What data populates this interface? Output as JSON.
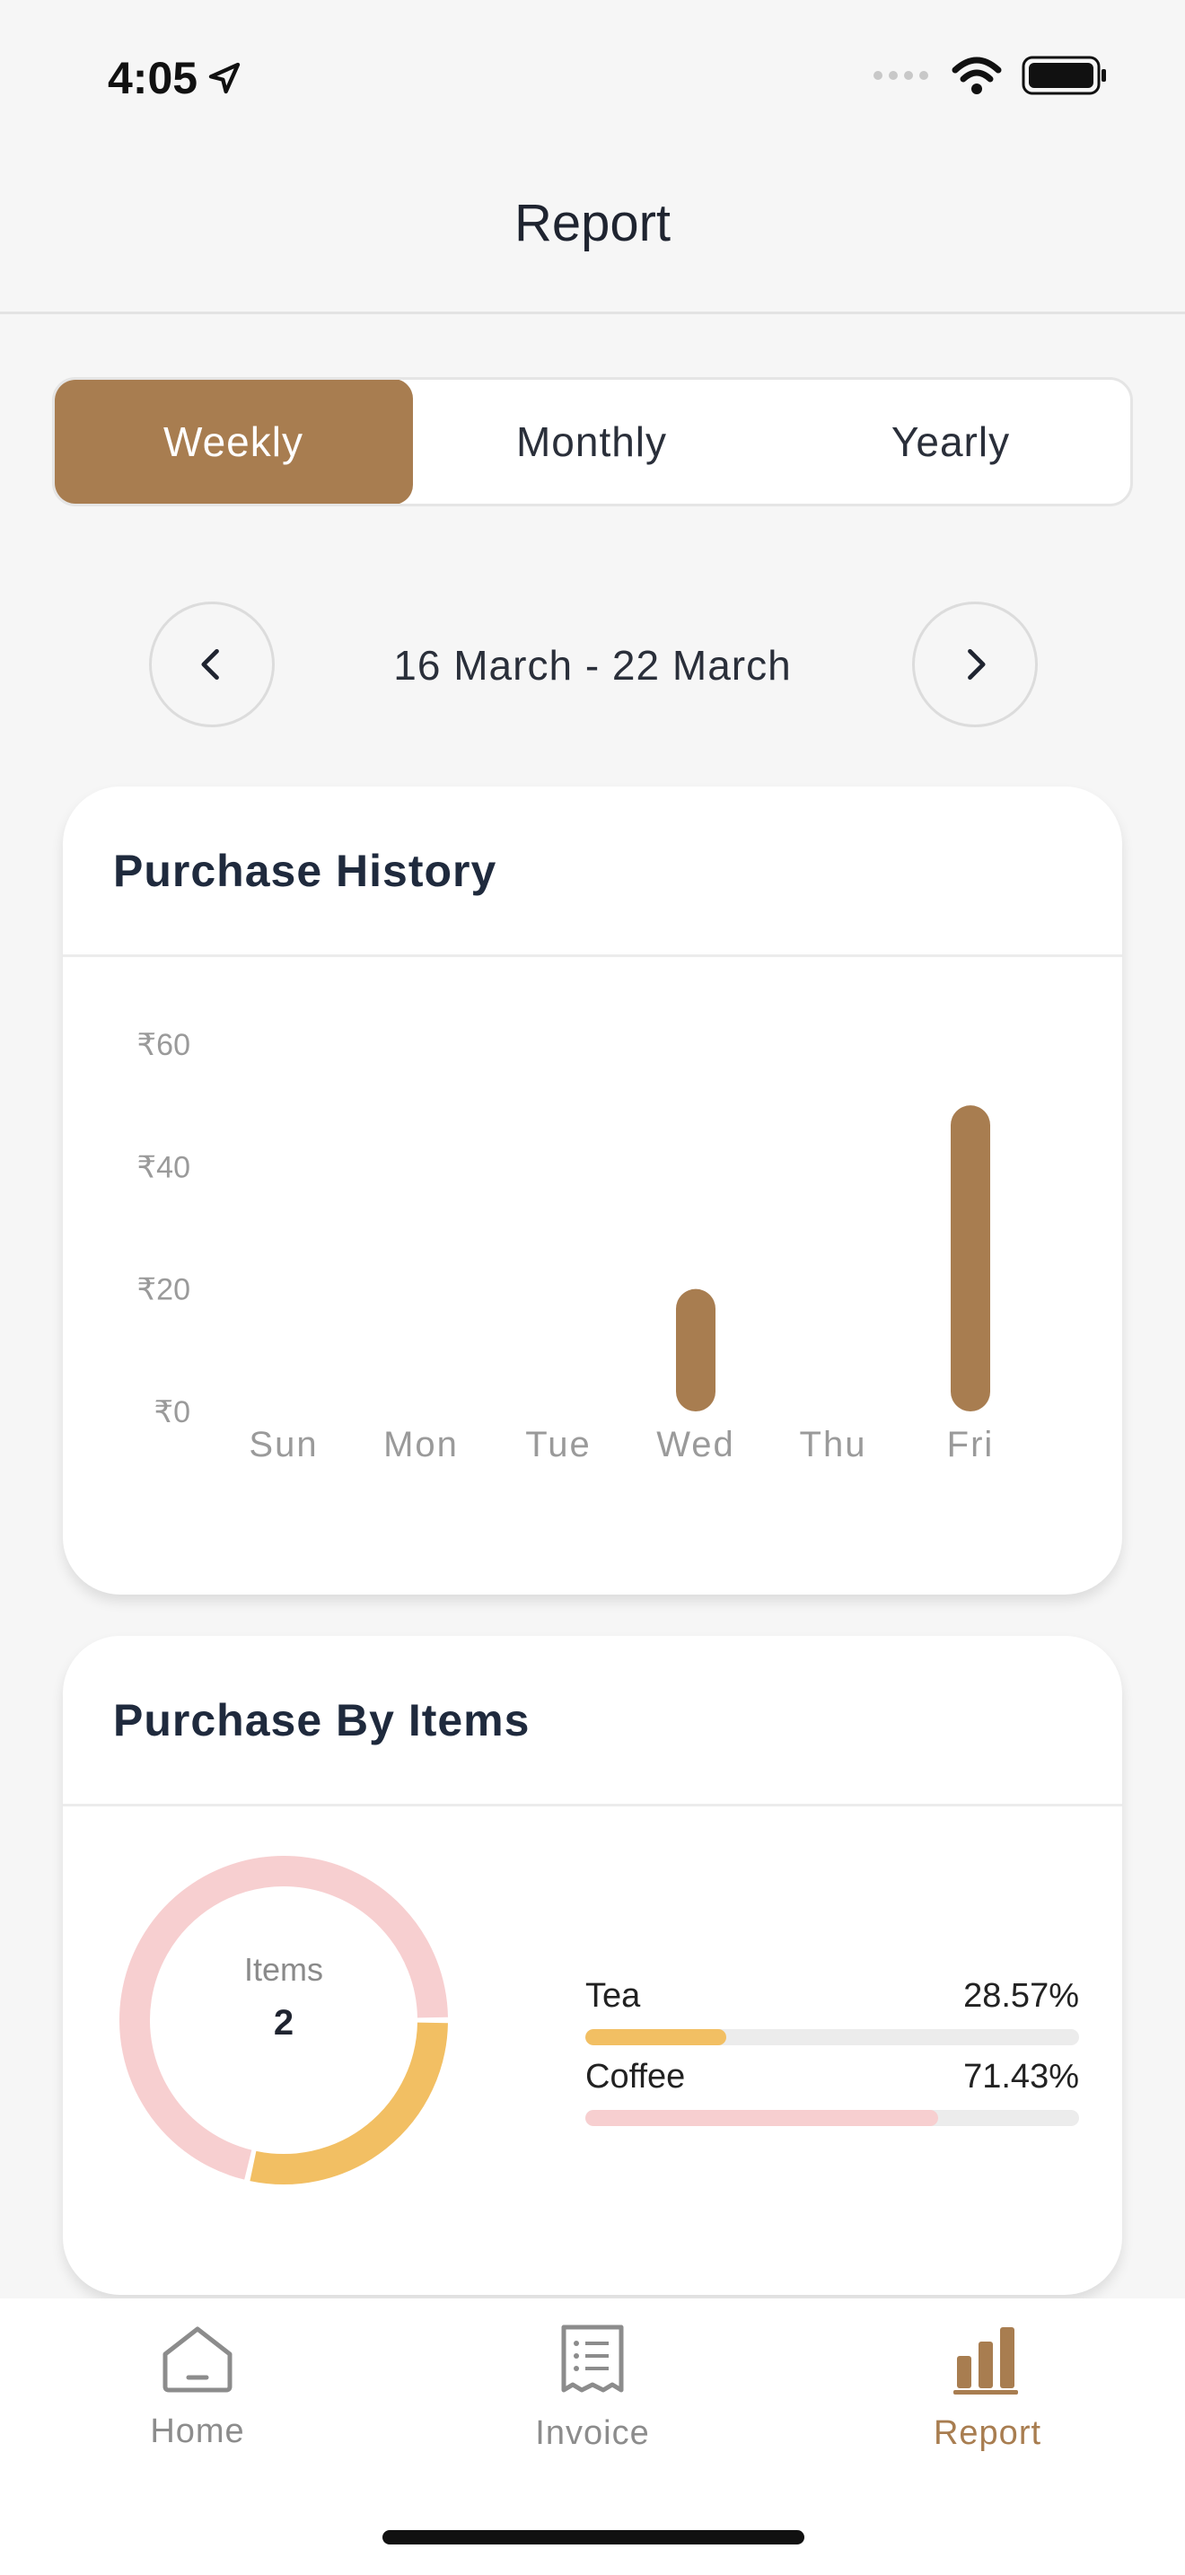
{
  "status": {
    "time": "4:05"
  },
  "header": {
    "title": "Report"
  },
  "period_tabs": [
    {
      "label": "Weekly",
      "active": true
    },
    {
      "label": "Monthly",
      "active": false
    },
    {
      "label": "Yearly",
      "active": false
    }
  ],
  "week_range": "16 March - 22 March",
  "icons": {
    "location": "location-arrow-icon",
    "signal": "signal-dots-icon",
    "wifi": "wifi-icon",
    "battery": "battery-icon",
    "prev": "chevron-left-icon",
    "next": "chevron-right-icon",
    "home": "home-icon",
    "invoice": "receipt-icon",
    "report": "bar-chart-icon"
  },
  "colors": {
    "accent": "#a87d50",
    "tea": "#f2bf63",
    "coffee": "#f7cfd0"
  },
  "purchase_history": {
    "title": "Purchase History",
    "chart_data": {
      "type": "bar",
      "categories": [
        "Sun",
        "Mon",
        "Tue",
        "Wed",
        "Thu",
        "Fri"
      ],
      "values": [
        0,
        0,
        0,
        20,
        0,
        50
      ],
      "yticks": [
        "₹0",
        "₹20",
        "₹40",
        "₹60"
      ],
      "ylim": [
        0,
        60
      ],
      "grid": false
    }
  },
  "purchase_by_items": {
    "title": "Purchase By Items",
    "center_label": "Items",
    "center_value": "2",
    "chart_data": {
      "type": "pie",
      "items": [
        {
          "name": "Tea",
          "value": 28.57,
          "label": "28.57%"
        },
        {
          "name": "Coffee",
          "value": 71.43,
          "label": "71.43%"
        }
      ]
    }
  },
  "tabbar": [
    {
      "label": "Home",
      "active": false
    },
    {
      "label": "Invoice",
      "active": false
    },
    {
      "label": "Report",
      "active": true
    }
  ]
}
